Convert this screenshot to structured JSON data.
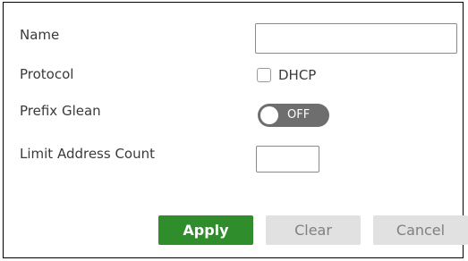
{
  "form": {
    "name_label": "Name",
    "name_value": "",
    "protocol_label": "Protocol",
    "dhcp_label": "DHCP",
    "dhcp_checked": false,
    "prefix_glean_label": "Prefix Glean",
    "prefix_glean_state": "OFF",
    "limit_address_count_label": "Limit Address Count",
    "limit_address_count_value": ""
  },
  "buttons": {
    "apply": "Apply",
    "clear": "Clear",
    "cancel": "Cancel"
  },
  "colors": {
    "apply_bg": "#2f8d2b",
    "secondary_bg": "#e1e1e1",
    "toggle_off_bg": "#6e6e6e"
  }
}
